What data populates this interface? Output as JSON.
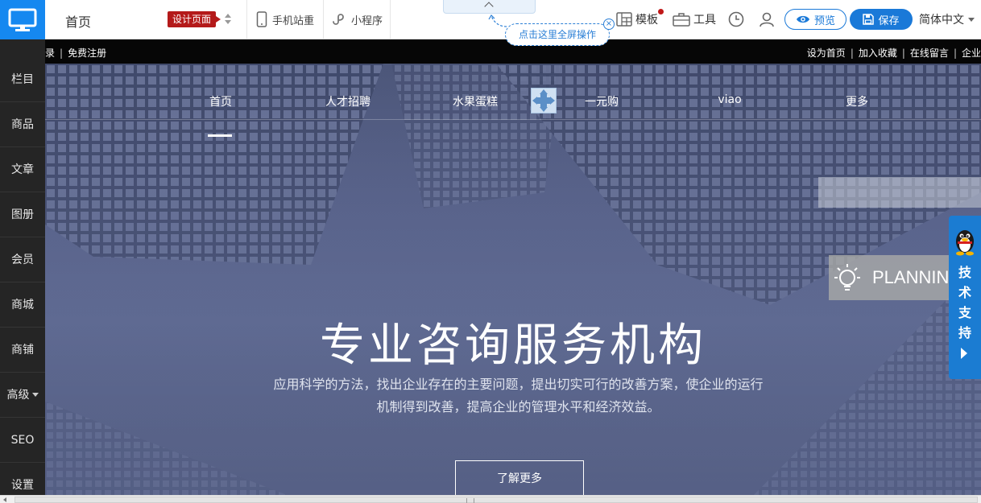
{
  "toolbar": {
    "page_title": "首页",
    "design_badge": "设计页面",
    "mobile_site": "手机站重",
    "mini_program": "小程序",
    "fullscreen_tip": "点击这里全屏操作",
    "template": "模板",
    "tools": "工具",
    "preview": "预览",
    "save": "保存",
    "language": "简体中文"
  },
  "sidebar": {
    "items": [
      {
        "label": "栏目"
      },
      {
        "label": "商品"
      },
      {
        "label": "文章"
      },
      {
        "label": "图册"
      },
      {
        "label": "会员"
      },
      {
        "label": "商城"
      },
      {
        "label": "商铺"
      },
      {
        "label": "高级"
      },
      {
        "label": "SEO"
      },
      {
        "label": "设置"
      }
    ]
  },
  "topstrip": {
    "left_cut": "录",
    "register": "免费注册",
    "set_home": "设为首页",
    "bookmark": "加入收藏",
    "message": "在线留言",
    "enterprise_cut": "企业"
  },
  "hero": {
    "nav": [
      {
        "label": "首页"
      },
      {
        "label": "人才招聘"
      },
      {
        "label": "水果蛋糕"
      },
      {
        "label": "一元购"
      },
      {
        "label": "viao"
      },
      {
        "label": "更多"
      }
    ],
    "title": "专业咨询服务机构",
    "desc_line1": "应用科学的方法，找出企业存在的主要问题，提出切实可行的改善方案，使企业的运行",
    "desc_line2": "机制得到改善，提高企业的管理水平和经济效益。",
    "button": "了解更多",
    "planning": "PLANNING"
  },
  "support": {
    "label": "技术支持"
  },
  "colors": {
    "brand_blue": "#1588f0",
    "badge_red": "#b41a1a",
    "sidebar_bg": "#252525",
    "hero_bg": "#58628a"
  }
}
